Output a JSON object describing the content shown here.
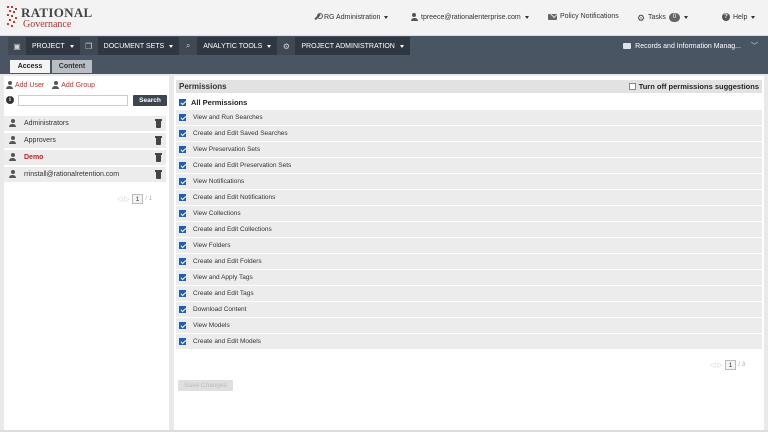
{
  "brand": {
    "name_line1": "RATIONAL",
    "name_line2": "Governance",
    "accent": "#c0392b"
  },
  "header": {
    "admin": "RG Administration",
    "user": "tpreece@rationalenterprise.com",
    "notifications": "Policy Notifications",
    "tasks": "Tasks",
    "tasks_count": "0",
    "help": "Help"
  },
  "nav": {
    "items": [
      {
        "label": "PROJECT",
        "icon": "briefcase-icon"
      },
      {
        "label": "DOCUMENT SETS",
        "icon": "copy-icon"
      },
      {
        "label": "ANALYTIC TOOLS",
        "icon": "search-icon"
      },
      {
        "label": "PROJECT ADMINISTRATION",
        "icon": "gear-icon"
      }
    ],
    "right_label": "Records and Information Manag..."
  },
  "tabs": {
    "access": "Access",
    "content": "Content"
  },
  "left": {
    "add_user": "Add User",
    "add_group": "Add Group",
    "search_placeholder": "",
    "search_button": "Search",
    "groups": [
      {
        "name": "Administrators",
        "selected": false
      },
      {
        "name": "Approvers",
        "selected": false
      },
      {
        "name": "Demo",
        "selected": true
      },
      {
        "name": "rrinstall@rationalretention.com",
        "selected": false
      }
    ],
    "pager": {
      "page": "1",
      "total": "/ 1"
    }
  },
  "right": {
    "header": "Permissions",
    "suggestions_label": "Turn off permissions suggestions",
    "suggestions_checked": false,
    "all_permissions": "All Permissions",
    "permissions": [
      "View and Run Searches",
      "Create and Edit Saved Searches",
      "View Preservation Sets",
      "Create and Edit Preservation Sets",
      "View Notifications",
      "Create and Edit Notifications",
      "View Collections",
      "Create and Edit Collections",
      "View Folders",
      "Create and Edit Folders",
      "View and Apply Tags",
      "Create and Edit Tags",
      "Download Content",
      "View Models",
      "Create and Edit Models"
    ],
    "pager": {
      "page": "1",
      "total": "/ 3"
    },
    "save_button": "Save Changes"
  }
}
